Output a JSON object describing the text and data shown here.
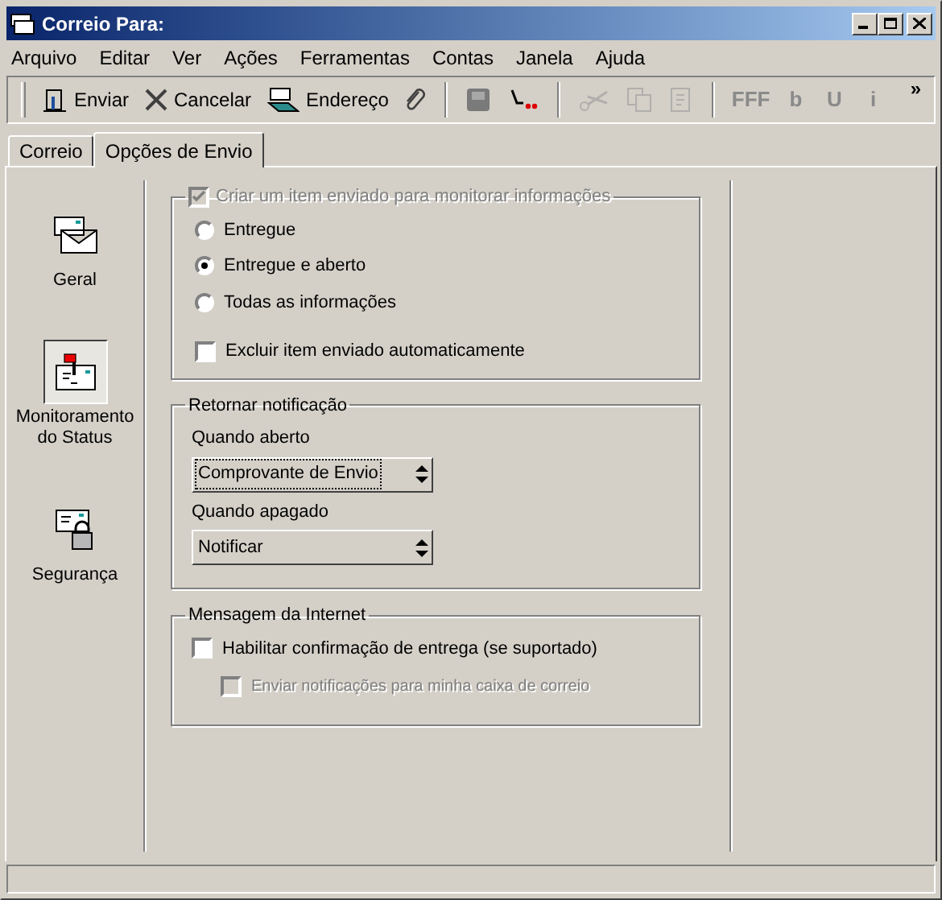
{
  "window": {
    "title": "Correio Para:"
  },
  "menu": [
    "Arquivo",
    "Editar",
    "Ver",
    "Ações",
    "Ferramentas",
    "Contas",
    "Janela",
    "Ajuda"
  ],
  "toolbar": [
    {
      "kind": "send",
      "label": "Enviar",
      "disabled": false
    },
    {
      "kind": "cancel",
      "label": "Cancelar",
      "disabled": false
    },
    {
      "kind": "address",
      "label": "Endereço",
      "disabled": false
    },
    {
      "kind": "attach",
      "disabled": false
    },
    {
      "kind": "sep"
    },
    {
      "kind": "save",
      "disabled": false
    },
    {
      "kind": "flag",
      "disabled": false
    },
    {
      "kind": "sep"
    },
    {
      "kind": "cut",
      "disabled": true
    },
    {
      "kind": "copy",
      "disabled": true
    },
    {
      "kind": "paste",
      "disabled": true
    },
    {
      "kind": "sep"
    },
    {
      "kind": "glyph",
      "label": "FFF",
      "disabled": true
    },
    {
      "kind": "glyph",
      "label": "b",
      "disabled": true
    },
    {
      "kind": "glyph",
      "label": "U",
      "disabled": true
    },
    {
      "kind": "glyph",
      "label": "i",
      "disabled": true
    }
  ],
  "toolbar_overflow": "»",
  "tabs": [
    {
      "label": "Correio",
      "selected": false
    },
    {
      "label": "Opções de Envio",
      "selected": true
    }
  ],
  "sidebar": [
    {
      "kind": "general",
      "label": "Geral",
      "selected": false
    },
    {
      "kind": "status",
      "label": "Monitoramento do Status",
      "selected": true
    },
    {
      "kind": "security",
      "label": "Segurança",
      "selected": false
    }
  ],
  "tracking": {
    "checkbox": {
      "label": "Criar um item enviado para monitorar informações",
      "checked": true,
      "disabled": true
    },
    "options": [
      {
        "label": "Entregue",
        "selected": false
      },
      {
        "label": "Entregue e aberto",
        "selected": true
      },
      {
        "label": "Todas as informações",
        "selected": false
      }
    ],
    "auto_delete": {
      "label": "Excluir item enviado automaticamente",
      "checked": false,
      "disabled": false
    }
  },
  "return_notification": {
    "title": "Retornar notificação",
    "fields": [
      {
        "label": "Quando aberto",
        "value": "Comprovante de Envio",
        "focused": true
      },
      {
        "label": "Quando apagado",
        "value": "Notificar",
        "focused": false
      }
    ]
  },
  "internet": {
    "title": "Mensagem da Internet",
    "checkboxes": [
      {
        "label": "Habilitar confirmação de entrega (se suportado)",
        "checked": false,
        "disabled": false,
        "children": [
          {
            "label": "Enviar notificações para minha caixa de correio",
            "checked": false,
            "disabled": true
          }
        ]
      }
    ]
  }
}
